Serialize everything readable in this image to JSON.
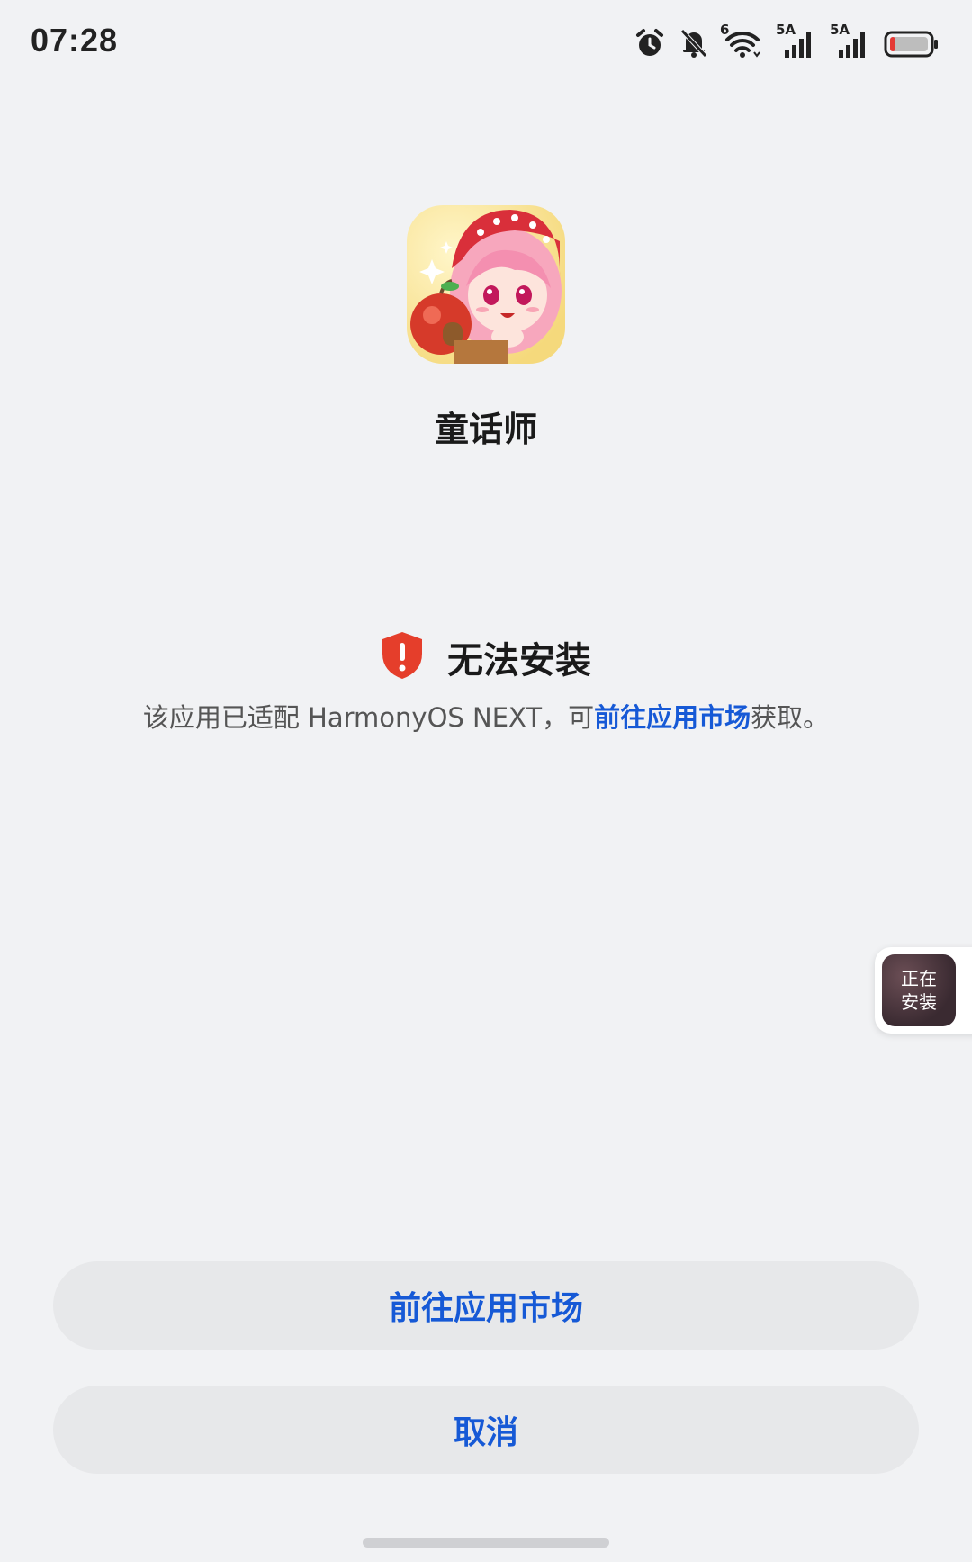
{
  "status_bar": {
    "time": "07:28",
    "icons": [
      "alarm-icon",
      "mute-bell-icon",
      "wifi-6-icon",
      "signal-5g-icon",
      "signal-5g-icon",
      "battery-icon"
    ],
    "wifi_label": "6",
    "signal_1_label": "5A",
    "signal_2_label": "5A",
    "battery_color": "#e53935"
  },
  "app": {
    "name": "童话师",
    "icon": "fairy-tale-app-icon"
  },
  "warning": {
    "icon": "shield-exclamation-icon",
    "title": "无法安装",
    "desc_prefix": "该应用已适配 HarmonyOS NEXT，可",
    "desc_link": "前往应用市场",
    "desc_suffix": "获取。",
    "shield_color": "#e53e2b",
    "link_color": "#1659d6"
  },
  "floating_widget": {
    "line1": "正在",
    "line2": "安装"
  },
  "buttons": {
    "market": "前往应用市场",
    "cancel": "取消"
  }
}
